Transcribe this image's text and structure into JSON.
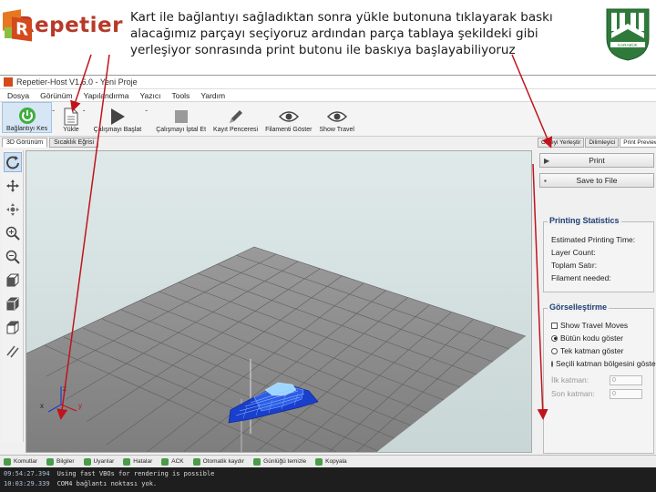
{
  "header": {
    "logo_text": "Repetier",
    "description": "Kart ile bağlantıyı sağladıktan sonra yükle butonuna tıklayarak baskı alacağımız parçayı seçiyoruz ardından parça tablaya şekildeki gibi yerleşiyor sonrasında print butonu ile baskıya başlayabiliyoruz",
    "seal_text": "KARABÜK"
  },
  "app": {
    "title": "Repetier-Host V1.6.0 - Yeni Proje",
    "menu": [
      "Dosya",
      "Görünüm",
      "Yapılandırma",
      "Yazıcı",
      "Tools",
      "Yardım"
    ],
    "toolbar": [
      {
        "label": "Bağlantıyı Kes",
        "icon": "power-icon",
        "active": true
      },
      {
        "label": "Yükle",
        "icon": "document-icon",
        "active": false
      },
      {
        "label": "Çalışmayı Başlat",
        "icon": "play-icon",
        "active": false
      },
      {
        "label": "Çalışmayı İptal Et",
        "icon": "stop-icon",
        "active": false
      },
      {
        "label": "Kayıt Penceresi",
        "icon": "pencil-icon",
        "active": false
      },
      {
        "label": "Filamenti Göster",
        "icon": "eye-icon",
        "active": false
      },
      {
        "label": "Show Travel",
        "icon": "eye-icon",
        "active": false
      }
    ],
    "view_tabs": [
      "3D Görünüm",
      "Sıcaklık Eğrisi"
    ],
    "side_tools": [
      "rotate-icon",
      "move-icon",
      "pan-icon",
      "zoom-in-icon",
      "zoom-out-icon",
      "cube-front-icon",
      "cube-side-icon",
      "cube-top-icon",
      "parallel-lines-icon"
    ],
    "right_tabs": [
      "Objeyi Yerleştir",
      "Dilimleyici",
      "Print Preview"
    ],
    "print_button": "Print",
    "save_button": "Save to File",
    "stats": {
      "title": "Printing Statistics",
      "lines": [
        "Estimated Printing Time:",
        "Layer Count:",
        "Toplam Satır:",
        "Filament needed:"
      ]
    },
    "visual": {
      "title": "Görselleştirme",
      "show_travel": "Show Travel Moves",
      "radios": [
        {
          "label": "Bütün kodu göster",
          "checked": true
        },
        {
          "label": "Tek katman göster",
          "checked": false
        },
        {
          "label": "Seçili katman bölgesini göster",
          "checked": false
        }
      ],
      "first_layer_label": "İlk katman:",
      "first_layer_value": "0",
      "last_layer_label": "Son katman:",
      "last_layer_value": "0"
    },
    "log_buttons": [
      "Komutlar",
      "Bilgiler",
      "Uyarılar",
      "Hatalar",
      "ACK",
      "Otomatik kaydır",
      "Günlüğü temizle",
      "Kopyala"
    ],
    "log_lines": [
      {
        "time": "09:54:27.394",
        "text": "Using fast VBOs for rendering is possible"
      },
      {
        "time": "10:03:29.339",
        "text": "COM4 bağlantı noktası yok."
      }
    ],
    "axis_labels": [
      "x",
      "y",
      "z"
    ]
  },
  "colors": {
    "accent_blue": "#1e4db8",
    "arrow_red": "#c0141c",
    "plate_gray": "#8e8e8e"
  }
}
